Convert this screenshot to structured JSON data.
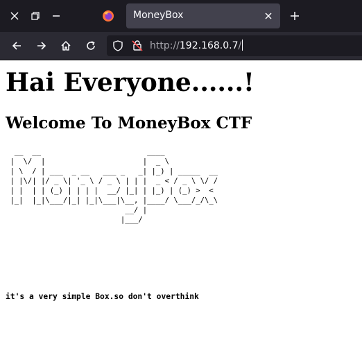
{
  "browser": {
    "tab": {
      "title": "MoneyBox"
    },
    "address_bar": {
      "scheme": "http://",
      "host": "192.168.0.7",
      "path": "/"
    },
    "icons": [
      "close-window-icon",
      "restore-window-icon",
      "minimize-window-icon",
      "firefox-icon",
      "tab-close-icon",
      "new-tab-icon",
      "back-icon",
      "forward-icon",
      "home-icon",
      "reload-icon",
      "shield-icon",
      "insecure-lock-icon"
    ],
    "colors": {
      "tabbar": "#1c1b22",
      "navbar": "#2b2a33",
      "active_tab": "#42414d"
    }
  },
  "page": {
    "heading": "Hai Everyone......!",
    "subheading": "Welcome To MoneyBox CTF",
    "ascii_art": "  __  __                        ____\n |  \\/  |                      |  _ \\\n | \\  / | ___  _ __   ___ _   _| |_) | _____  __\n | |\\/| |/ _ \\| '_ \\ / _ \\ | | |  _ < / _ \\ \\/ /\n | |  | | (_) | | | |  __/ |_| | |_) | (_) >  <\n |_|  |_|\\___/|_| |_|\\___|\\__, |____/ \\___/_/\\_\\\n                           __/ |\n                          |___/",
    "hint": "it's a very simple Box.so don't overthink"
  }
}
